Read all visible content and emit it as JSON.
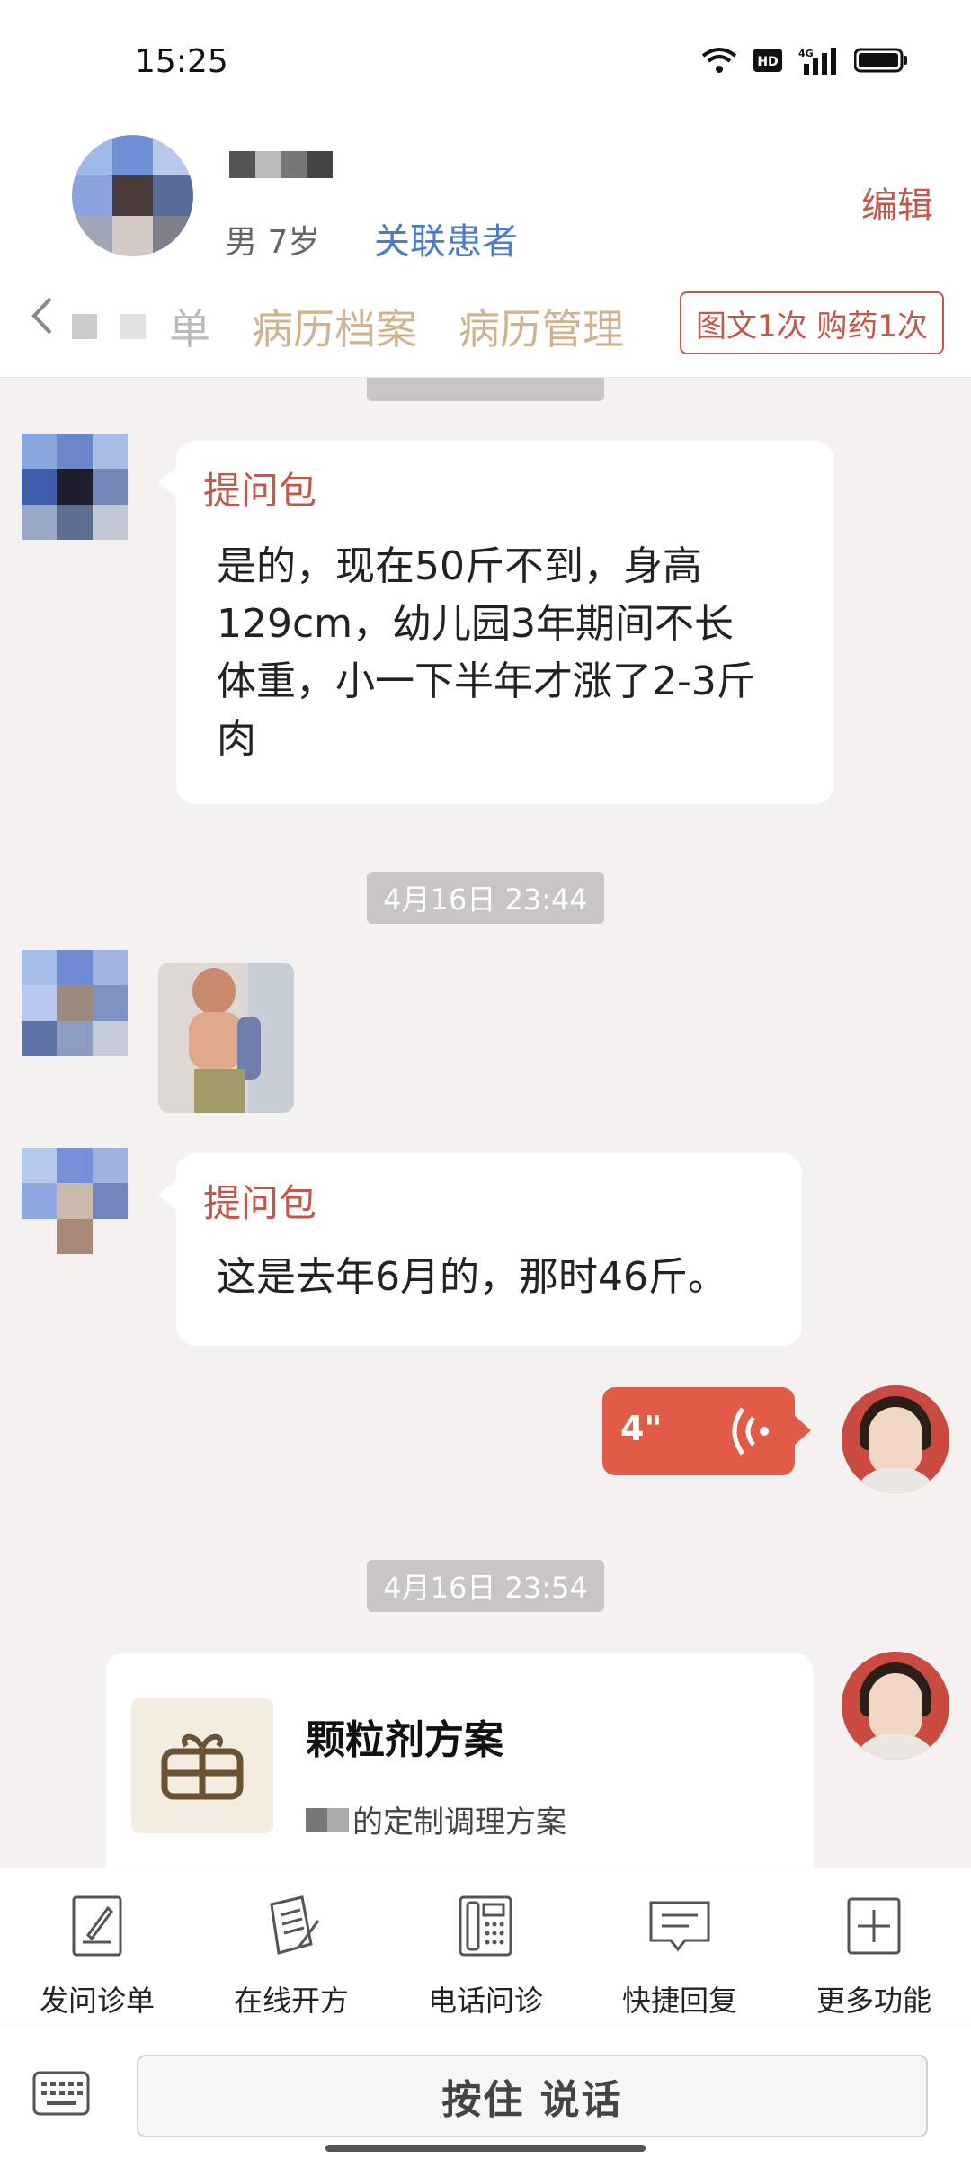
{
  "status_bar": {
    "time": "15:25"
  },
  "header": {
    "patient_meta": "男 7岁",
    "link_patient": "关联患者",
    "edit": "编辑",
    "tabs": [
      {
        "label": "单"
      },
      {
        "label": "病历档案"
      },
      {
        "label": "病历管理"
      }
    ],
    "quota": "图文1次 购药1次"
  },
  "chat": {
    "messages": [
      {
        "tag": "提问包",
        "lines": [
          "是的，现在50斤不到，身高",
          "129cm，幼儿园3年期间不长",
          "体重，小一下半年才涨了2-3斤",
          "肉"
        ]
      },
      {
        "timestamp": "4月16日 23:44"
      },
      {
        "tag": "提问包",
        "lines": [
          "这是去年6月的，那时46斤。"
        ]
      },
      {
        "voice_duration": "4\""
      },
      {
        "timestamp": "4月16日 23:54"
      }
    ],
    "card": {
      "title": "颗粒剂方案",
      "subtitle": "的定制调理方案"
    }
  },
  "toolbar": {
    "items": [
      {
        "label": "发问诊单",
        "icon": "form-icon"
      },
      {
        "label": "在线开方",
        "icon": "prescription-icon"
      },
      {
        "label": "电话问诊",
        "icon": "phone-icon"
      },
      {
        "label": "快捷回复",
        "icon": "quick-reply-icon"
      },
      {
        "label": "更多功能",
        "icon": "plus-icon"
      }
    ]
  },
  "input": {
    "hold_to_talk": "按住 说话"
  },
  "colors": {
    "accent": "#c4574a",
    "link": "#4a7ccc",
    "voice": "#e15b46"
  }
}
